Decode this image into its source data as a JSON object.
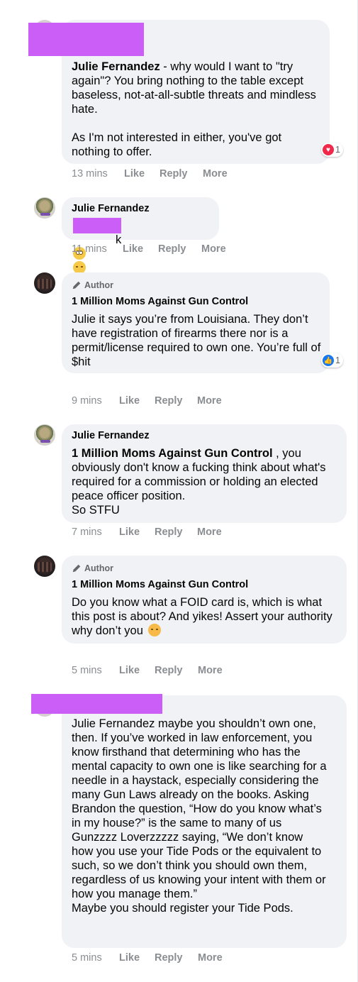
{
  "actions": {
    "like": "Like",
    "reply": "Reply",
    "more": "More"
  },
  "comments": [
    {
      "author": "",
      "text_mention": "Julie Fernandez",
      "text": " - why would I want to \"try again\"? You bring nothing to the table except baseless, not-at-all-subtle threats and mindless hate.\n\nAs I'm not interested in either, you've got nothing to offer.",
      "time": "13 mins",
      "reaction": {
        "icon": "heart-reaction",
        "count": "1"
      }
    },
    {
      "author": "Julie Fernandez",
      "text": "k",
      "emojis": [
        "face-with-rolling-eyes",
        "sleeping-face",
        "sleeping-face",
        "sleeping-face",
        "sleeping-face"
      ],
      "time": "11 mins"
    },
    {
      "badge": "Author",
      "author": "1 Million Moms Against Gun Control",
      "text": "Julie it says you’re from Louisiana. They don’t have registration of firearms there nor is a permit/license required to own one. You’re full of $hit",
      "time": "9 mins",
      "reaction": {
        "icon": "like-reaction",
        "count": "1"
      }
    },
    {
      "author": "Julie Fernandez",
      "text_mention": "1 Million Moms Against Gun Control",
      "text": " , you obviously don't know a fucking think about what's required for a commission or holding an elected peace officer position.\nSo STFU",
      "time": "7 mins"
    },
    {
      "badge": "Author",
      "author": "1 Million Moms Against Gun Control",
      "text": "Do you know what a FOID card is, which is what this post is about? And yikes! Assert your authority why don’t you",
      "emojis": [
        "rolling-on-floor-laughing"
      ],
      "time": "5 mins"
    },
    {
      "author": "",
      "text": "Julie Fernandez maybe you shouldn’t own one, then. If you’ve worked in law enforcement, you know firsthand that determining who has the mental capacity to own one is like searching for a needle in a haystack, especially considering the many Gun Laws already on the books. Asking Brandon the question, “How do you know what’s in my house?” is the same to many of us Gunzzzz Loverzzzzz saying, “We don’t know how you use your Tide Pods or the equivalent to such, so we don’t think you should own them, regardless of us knowing your intent with them or how you manage them.”\nMaybe you should register your Tide Pods.",
      "time": "5 mins"
    }
  ],
  "colors": {
    "bubble": "#f0f2f5",
    "redaction": "#cb5ef7",
    "meta": "#8a8d91",
    "heart": "#f02849",
    "like": "#1877f2"
  }
}
